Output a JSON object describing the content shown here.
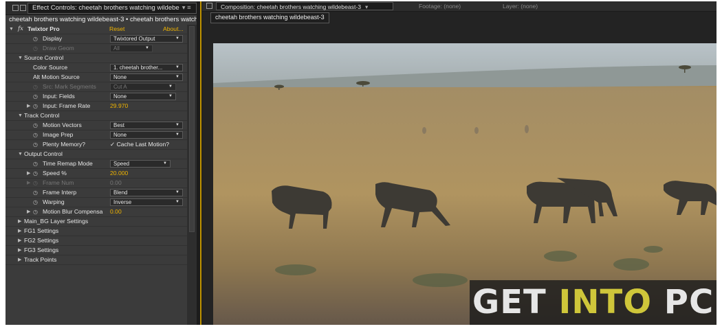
{
  "left_panel": {
    "tab_title": "Effect Controls: cheetah brothers watching wildebe",
    "breadcrumb": "cheetah brothers watching wildebeast-3 • cheetah brothers watching wildebeast-3",
    "effect": {
      "name": "Twixtor Pro",
      "reset": "Reset",
      "about": "About..."
    },
    "rows": {
      "display": {
        "label": "Display",
        "value": "Twixtored Output"
      },
      "draw_geom": {
        "label": "Draw Geom",
        "value": "All"
      },
      "source_control": {
        "label": "Source Control"
      },
      "color_source": {
        "label": "Color Source",
        "value": "1. cheetah brother..."
      },
      "alt_motion_source": {
        "label": "Alt Motion Source",
        "value": "None"
      },
      "src_mark_segments": {
        "label": "Src: Mark Segments",
        "value": "Cut A"
      },
      "input_fields": {
        "label": "Input: Fields",
        "value": "None"
      },
      "input_frame_rate": {
        "label": "Input: Frame Rate",
        "value": "29.970"
      },
      "track_control": {
        "label": "Track Control"
      },
      "motion_vectors": {
        "label": "Motion Vectors",
        "value": "Best"
      },
      "image_prep": {
        "label": "Image Prep",
        "value": "None"
      },
      "plenty_memory": {
        "label": "Plenty Memory?",
        "value": "✓ Cache Last Motion?"
      },
      "output_control": {
        "label": "Output Control"
      },
      "time_remap_mode": {
        "label": "Time Remap Mode",
        "value": "Speed"
      },
      "speed_pct": {
        "label": "Speed %",
        "value": "20.000"
      },
      "frame_num": {
        "label": "Frame Num",
        "value": "0.00"
      },
      "frame_interp": {
        "label": "Frame Interp",
        "value": "Blend"
      },
      "warping": {
        "label": "Warping",
        "value": "Inverse"
      },
      "motion_blur": {
        "label": "Motion Blur Compensa",
        "value": "0.00"
      },
      "main_bg": {
        "label": "Main_BG Layer Settings"
      },
      "fg1": {
        "label": "FG1 Settings"
      },
      "fg2": {
        "label": "FG2 Settings"
      },
      "fg3": {
        "label": "FG3 Settings"
      },
      "track_points": {
        "label": "Track Points"
      }
    }
  },
  "comp_panel": {
    "tab_title": "Composition: cheetah brothers watching wildebeast-3",
    "footage_tab": "Footage: (none)",
    "layer_tab": "Layer: (none)",
    "subtab": "cheetah brothers watching wildebeast-3"
  },
  "watermark": {
    "part1": "GET ",
    "part2": "INTO",
    "part3": " PC"
  },
  "colors": {
    "accent": "#f0b400",
    "panel_bg": "#3b3b3b",
    "watermark_green": "#cfc63a"
  }
}
